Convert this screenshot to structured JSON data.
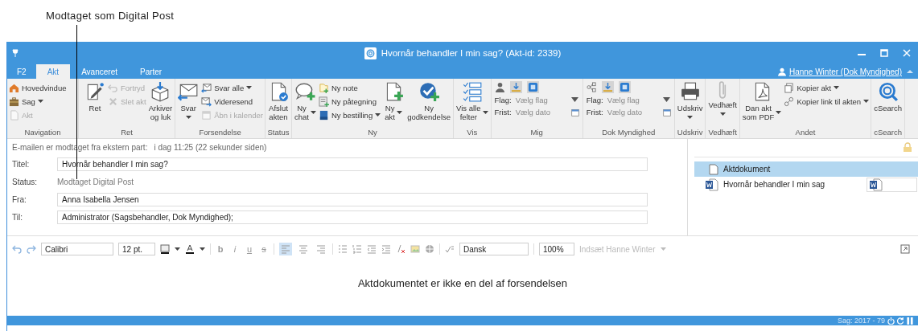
{
  "annotation": {
    "text": "Modtaget som Digital Post"
  },
  "window": {
    "title": "Hvornår behandler I min sag? (Akt-id: 2339)"
  },
  "tabs": [
    {
      "label": "F2",
      "selected": false
    },
    {
      "label": "Akt",
      "selected": true
    },
    {
      "label": "Avanceret",
      "selected": false
    },
    {
      "label": "Parter",
      "selected": false
    }
  ],
  "user": {
    "name": "Hanne Winter (Dok Myndighed)"
  },
  "ribbon_groups": [
    {
      "label": "Navigation",
      "items": [
        {
          "kind": "stack",
          "items": [
            {
              "label": "Hovedvindue",
              "dropdown": false,
              "disabled": false
            },
            {
              "label": "Sag",
              "dropdown": true,
              "disabled": false
            },
            {
              "label": "Akt",
              "dropdown": false,
              "disabled": true
            }
          ]
        }
      ]
    },
    {
      "label": "Ret",
      "items": [
        {
          "kind": "large",
          "label": "Ret",
          "dropdown": false,
          "disabled": false
        },
        {
          "kind": "stack",
          "items": [
            {
              "label": "Fortryd",
              "dropdown": false,
              "disabled": true
            },
            {
              "label": "Slet akt",
              "dropdown": false,
              "disabled": true
            }
          ]
        },
        {
          "kind": "large",
          "label": "Arkiver\nog luk",
          "dropdown": false,
          "disabled": false
        }
      ]
    },
    {
      "label": "Forsendelse",
      "items": [
        {
          "kind": "large",
          "label": "Svar",
          "dropdown": true,
          "disabled": false
        },
        {
          "kind": "stack",
          "items": [
            {
              "label": "Svar alle",
              "dropdown": true,
              "disabled": false
            },
            {
              "label": "Videresend",
              "dropdown": false,
              "disabled": false
            },
            {
              "label": "Åbn i kalender",
              "dropdown": false,
              "disabled": true
            }
          ]
        }
      ]
    },
    {
      "label": "Status",
      "items": [
        {
          "kind": "large",
          "label": "Afslut\nakten",
          "dropdown": false,
          "disabled": false
        }
      ]
    },
    {
      "label": "Ny",
      "items": [
        {
          "kind": "large",
          "label": "Ny\nchat",
          "dropdown": true,
          "disabled": false
        },
        {
          "kind": "stack",
          "items": [
            {
              "label": "Ny note",
              "dropdown": false,
              "disabled": false
            },
            {
              "label": "Ny påtegning",
              "dropdown": false,
              "disabled": false
            },
            {
              "label": "Ny bestilling",
              "dropdown": true,
              "disabled": false
            }
          ]
        },
        {
          "kind": "large",
          "label": "Ny\nakt",
          "dropdown": true,
          "disabled": false
        },
        {
          "kind": "large",
          "label": "Ny\ngodkendelse",
          "dropdown": false,
          "disabled": false
        }
      ]
    },
    {
      "label": "Vis",
      "items": [
        {
          "kind": "large",
          "label": "Vis alle\nfelter",
          "dropdown": true,
          "disabled": false
        }
      ]
    },
    {
      "label": "Mig",
      "items": [
        {
          "kind": "flags",
          "rows": [
            {
              "label": "Flag:",
              "placeholder": "Vælg flag"
            },
            {
              "label": "Frist:",
              "placeholder": "Vælg dato"
            }
          ]
        }
      ]
    },
    {
      "label": "Dok Myndighed",
      "items": [
        {
          "kind": "flags",
          "rows": [
            {
              "label": "Flag:",
              "placeholder": "Vælg flag"
            },
            {
              "label": "Frist:",
              "placeholder": "Vælg dato"
            }
          ]
        }
      ]
    },
    {
      "label": "Udskriv",
      "items": [
        {
          "kind": "large",
          "label": "Udskriv",
          "dropdown": true,
          "disabled": false
        }
      ]
    },
    {
      "label": "Vedhæft",
      "items": [
        {
          "kind": "large",
          "label": "Vedhæft",
          "dropdown": true,
          "disabled": false
        }
      ]
    },
    {
      "label": "Andet",
      "items": [
        {
          "kind": "large",
          "label": "Dan akt\nsom PDF",
          "dropdown": true,
          "disabled": false
        },
        {
          "kind": "stack",
          "items": [
            {
              "label": "Kopier akt",
              "dropdown": true,
              "disabled": false
            },
            {
              "label": "Kopier link til akten",
              "dropdown": true,
              "disabled": false
            }
          ]
        }
      ]
    },
    {
      "label": "cSearch",
      "items": [
        {
          "kind": "large",
          "label": "cSearch",
          "dropdown": false,
          "disabled": false
        }
      ]
    }
  ],
  "received": {
    "label": "E-mailen er modtaget fra ekstern part:",
    "value": "i dag 11:25 (22 sekunder siden)"
  },
  "fields": [
    {
      "label": "Titel:",
      "value": "Hvornår behandler I min sag?",
      "kind": "input"
    },
    {
      "label": "Status:",
      "value": "Modtaget Digital Post",
      "kind": "text"
    },
    {
      "label": "Fra:",
      "value": "Anna Isabella Jensen",
      "kind": "input"
    },
    {
      "label": "Til:",
      "value": "Administrator (Sagsbehandler, Dok Myndighed);",
      "kind": "input"
    }
  ],
  "documents": [
    {
      "name": "Aktdokument",
      "kind": "plain",
      "selected": true
    },
    {
      "name": "Hvornår behandler I min sag",
      "kind": "word",
      "selected": false
    }
  ],
  "editor": {
    "font": "Calibri",
    "size": "12 pt.",
    "format": [
      {
        "label": "b",
        "kind": "bold"
      },
      {
        "label": "i",
        "kind": "italic"
      },
      {
        "label": "u",
        "kind": "underline"
      },
      {
        "label": "s",
        "kind": "strike"
      }
    ],
    "align": [
      {
        "selected": true
      },
      {
        "selected": false
      },
      {
        "selected": false
      }
    ],
    "language": "Dansk",
    "zoom": "100%",
    "insert": {
      "label": "Indsæt Hanne Winter",
      "disabled": true
    },
    "body": "Aktdokumentet er ikke en del af forsendelsen"
  },
  "status_bar": {
    "text": "Sag: 2017 - 79"
  }
}
